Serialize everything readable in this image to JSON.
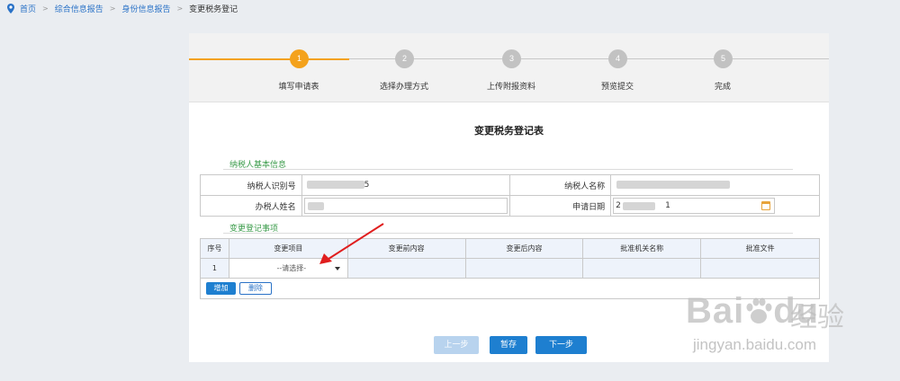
{
  "breadcrumb": {
    "items": [
      "首页",
      "综合信息报告",
      "身份信息报告"
    ],
    "current": "变更税务登记",
    "separator": ">"
  },
  "steps": [
    {
      "num": "1",
      "label": "填写申请表",
      "active": true
    },
    {
      "num": "2",
      "label": "选择办理方式",
      "active": false
    },
    {
      "num": "3",
      "label": "上传附报资料",
      "active": false
    },
    {
      "num": "4",
      "label": "预览提交",
      "active": false
    },
    {
      "num": "5",
      "label": "完成",
      "active": false
    }
  ],
  "form": {
    "title": "变更税务登记表",
    "section_basic": "纳税人基本信息",
    "taxpayer_id_label": "纳税人识别号",
    "taxpayer_id_value_partial": "5",
    "taxpayer_name_label": "纳税人名称",
    "handler_name_label": "办税人姓名",
    "apply_date_label": "申请日期",
    "apply_date_partial_start": "2",
    "apply_date_partial_end": "1",
    "section_changes": "变更登记事项"
  },
  "changes_table": {
    "headers": [
      "序号",
      "变更项目",
      "变更前内容",
      "变更后内容",
      "批准机关名称",
      "批准文件"
    ],
    "rows": [
      {
        "seq": "1",
        "item_placeholder": "--请选择-",
        "before": "",
        "after": "",
        "authority": "",
        "document": ""
      }
    ],
    "add_button": "增加",
    "delete_button": "删除"
  },
  "buttons": {
    "prev": "上一步",
    "save": "暂存",
    "next": "下一步"
  },
  "watermark": {
    "brand": "Bai",
    "brand_end": "du",
    "cn": "经验",
    "url": "jingyan.baidu.com"
  },
  "colors": {
    "accent": "#f4a21c",
    "primary": "#1e7fd0",
    "section_green": "#3a9b4a",
    "link": "#2a72c7"
  }
}
